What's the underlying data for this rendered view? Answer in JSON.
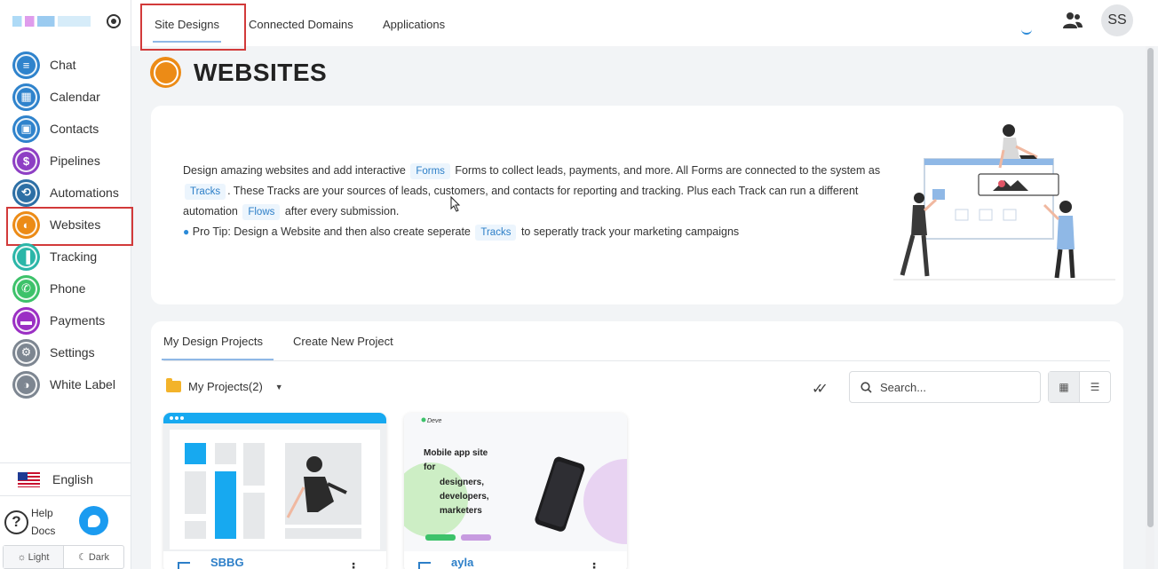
{
  "sidebar": {
    "items": [
      {
        "label": "Chat",
        "color": "#2f83cc",
        "glyph": "≡"
      },
      {
        "label": "Calendar",
        "color": "#2f83cc",
        "glyph": "▦"
      },
      {
        "label": "Contacts",
        "color": "#2f83cc",
        "glyph": "▣"
      },
      {
        "label": "Pipelines",
        "color": "#8e3fc4",
        "glyph": "$"
      },
      {
        "label": "Automations",
        "color": "#2d6fa5",
        "glyph": "⟲"
      },
      {
        "label": "Websites",
        "color": "#ec8b16",
        "glyph": "◐"
      },
      {
        "label": "Tracking",
        "color": "#2bb6a8",
        "glyph": "▐"
      },
      {
        "label": "Phone",
        "color": "#3dc26a",
        "glyph": "✆"
      },
      {
        "label": "Payments",
        "color": "#9b2fc4",
        "glyph": "▬"
      },
      {
        "label": "Settings",
        "color": "#7d8691",
        "glyph": "⚙"
      },
      {
        "label": "White Label",
        "color": "#7d8691",
        "glyph": "◑"
      }
    ],
    "active": "Websites",
    "language": "English",
    "help_label_1": "Help",
    "help_label_2": "Docs",
    "theme_light": "Light",
    "theme_dark": "Dark"
  },
  "topbar": {
    "tabs": [
      "Site Designs",
      "Connected Domains",
      "Applications"
    ],
    "active_tab": "Site Designs",
    "avatar_initials": "SS"
  },
  "page": {
    "title": "WEBSITES"
  },
  "intro": {
    "line1_a": "Design amazing websites and add interactive",
    "chip_forms": "Forms",
    "line1_b": "Forms to collect leads, payments, and more. All Forms are connected to the system as",
    "chip_tracks": "Tracks",
    "line2_b": ". These Tracks are your sources of leads, customers, and contacts for reporting and tracking. Plus each Track can run a different",
    "line3_a": "automation",
    "chip_flows": "Flows",
    "line3_b": "after every submission.",
    "tip_a": "Pro Tip: Design a Website and then also create seperate",
    "chip_tracks2": "Tracks",
    "tip_b": "to seperatly track your marketing campaigns"
  },
  "projects": {
    "tabs": [
      "My Design Projects",
      "Create New Project"
    ],
    "active_tab": "My Design Projects",
    "folder_label": "My Projects(2)",
    "search_placeholder": "Search...",
    "items": [
      {
        "name": "SBBG"
      },
      {
        "name": "ayla",
        "thumb_brand": "Deve",
        "thumb_headline_1": "Mobile app site",
        "thumb_headline_2": "for",
        "thumb_headline_3": "designers,",
        "thumb_headline_4": "developers,",
        "thumb_headline_5": "marketers"
      }
    ]
  }
}
